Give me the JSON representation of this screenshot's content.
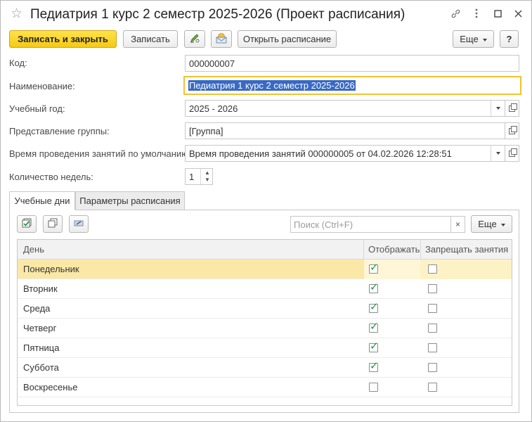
{
  "window": {
    "title": "Педиатрия 1 курс 2 семестр 2025-2026 (Проект расписания)"
  },
  "toolbar": {
    "save_close": "Записать и закрыть",
    "save": "Записать",
    "open_schedule": "Открыть расписание",
    "more": "Еще",
    "help": "?"
  },
  "form": {
    "code_label": "Код:",
    "code_value": "000000007",
    "name_label": "Наименование:",
    "name_value": "Педиатрия 1 курс 2 семестр 2025-2026",
    "year_label": "Учебный год:",
    "year_value": "2025 - 2026",
    "group_label": "Представление группы:",
    "group_value": "[Группа]",
    "time_label": "Время проведения занятий по умолчанию:",
    "time_value": "Время проведения занятий 000000005 от 04.02.2026 12:28:51",
    "weeks_label": "Количество недель:",
    "weeks_value": "1"
  },
  "tabs": [
    {
      "label": "Учебные дни"
    },
    {
      "label": "Параметры расписания"
    }
  ],
  "table_toolbar": {
    "search_placeholder": "Поиск (Ctrl+F)",
    "clear": "×",
    "more": "Еще"
  },
  "table": {
    "columns": [
      "День",
      "Отображать",
      "Запрещать занятия"
    ],
    "rows": [
      {
        "day": "Понедельник",
        "show": true,
        "forbid": false
      },
      {
        "day": "Вторник",
        "show": true,
        "forbid": false
      },
      {
        "day": "Среда",
        "show": true,
        "forbid": false
      },
      {
        "day": "Четверг",
        "show": true,
        "forbid": false
      },
      {
        "day": "Пятница",
        "show": true,
        "forbid": false
      },
      {
        "day": "Суббота",
        "show": true,
        "forbid": false
      },
      {
        "day": "Воскресенье",
        "show": false,
        "forbid": false
      }
    ],
    "selected_row": 0
  },
  "colors": {
    "primary_button": "#f6c914",
    "focus_border": "#f1c232",
    "selection": "#3869c5",
    "row_selected": "#fbe8a6",
    "check": "#1e9e43"
  },
  "icons": [
    "star-icon",
    "link-icon",
    "more-vert-icon",
    "maximize-icon",
    "close-icon",
    "pen-sign-icon",
    "envelope-icon",
    "check-all-icon",
    "copy-icon",
    "uncheck-icon",
    "open-form-icon"
  ]
}
